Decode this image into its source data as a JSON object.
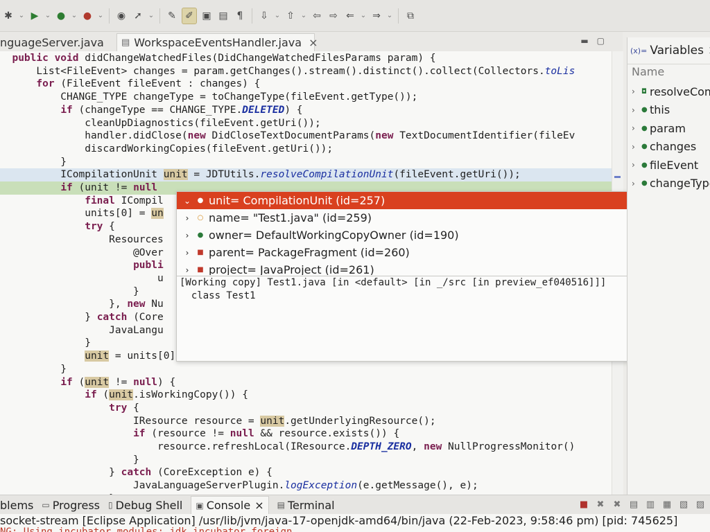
{
  "editor": {
    "tabs": [
      {
        "label": "nguageServer.java"
      },
      {
        "label": "WorkspaceEventsHandler.java",
        "close": "×"
      }
    ]
  },
  "code_lines": [
    [
      "  ",
      {
        "k": "public void"
      },
      " didChangeWatchedFiles(DidChangeWatchedFilesParams param) {"
    ],
    [
      "      List<FileEvent> changes = param.getChanges().stream().distinct().collect(Collectors.",
      {
        "f": "toLis"
      }
    ],
    [
      "      ",
      {
        "k": "for"
      },
      " (FileEvent fileEvent : changes) {"
    ],
    [
      "          CHANGE_TYPE changeType = toChangeType(fileEvent.getType());"
    ],
    [
      "          ",
      {
        "k": "if"
      },
      " (changeType == CHANGE_TYPE.",
      {
        "c": "DELETED"
      },
      ") {"
    ],
    [
      "              cleanUpDiagnostics(fileEvent.getUri());"
    ],
    [
      "              handler.didClose(",
      {
        "k": "new"
      },
      " DidCloseTextDocumentParams(",
      {
        "k": "new"
      },
      " TextDocumentIdentifier(fileEv"
    ],
    [
      "              discardWorkingCopies(fileEvent.getUri());"
    ],
    [
      "          }"
    ],
    [
      "          ICompilationUnit ",
      {
        "o": "unit"
      },
      " = JDTUtils.",
      {
        "f": "resolveCompilationUnit"
      },
      "(fileEvent.getUri());"
    ],
    [
      "          ",
      {
        "k": "if"
      },
      " (unit != ",
      {
        "k": "null"
      }
    ],
    [
      "              ",
      {
        "k": "final"
      },
      " ICompil"
    ],
    [
      "              units[0] = ",
      {
        "o": "un"
      }
    ],
    [
      "              ",
      {
        "k": "try"
      },
      " {"
    ],
    [
      "                  Resources"
    ],
    [
      "                      @Over"
    ],
    [
      "                      ",
      {
        "k": "publi"
      }
    ],
    [
      "                          u"
    ],
    [
      "                      }"
    ],
    [
      "                  }, ",
      {
        "k": "new"
      },
      " Nu"
    ],
    [
      "              } ",
      {
        "k": "catch"
      },
      " (Core"
    ],
    [
      "                  JavaLangu"
    ],
    [
      "              }"
    ],
    [
      "              ",
      {
        "o": "unit"
      },
      " = units[0];"
    ],
    [
      "          }"
    ],
    [
      "          ",
      {
        "k": "if"
      },
      " (",
      {
        "o": "unit"
      },
      " != ",
      {
        "k": "null"
      },
      ") {"
    ],
    [
      "              ",
      {
        "k": "if"
      },
      " (",
      {
        "o": "unit"
      },
      ".isWorkingCopy()) {"
    ],
    [
      "                  ",
      {
        "k": "try"
      },
      " {"
    ],
    [
      "                      IResource resource = ",
      {
        "o": "unit"
      },
      ".getUnderlyingResource();"
    ],
    [
      "                      ",
      {
        "k": "if"
      },
      " (resource != ",
      {
        "k": "null"
      },
      " && resource.exists()) {"
    ],
    [
      "                          resource.refreshLocal(IResource.",
      {
        "c": "DEPTH_ZERO"
      },
      ", ",
      {
        "k": "new"
      },
      " NullProgressMonitor()"
    ],
    [
      "                      }"
    ],
    [
      "                  } ",
      {
        "k": "catch"
      },
      " (CoreException e) {"
    ],
    [
      "                      JavaLanguageServerPlugin.",
      {
        "f": "logException"
      },
      "(e.getMessage(), e);"
    ],
    [
      "                  }"
    ]
  ],
  "hover": {
    "tree": [
      {
        "twisty": "⌄",
        "dot": "●",
        "dot_color": "blue",
        "label": "unit= CompilationUnit  (id=257)",
        "selected": true
      },
      {
        "twisty": "›",
        "dot": "○",
        "dot_color": "orange",
        "label": "name= \"Test1.java\" (id=259)"
      },
      {
        "twisty": "›",
        "dot": "●",
        "dot_color": "blue",
        "label": "owner= DefaultWorkingCopyOwner  (id=190)"
      },
      {
        "twisty": "›",
        "dot": "■",
        "dot_color": "red",
        "label": "parent= PackageFragment  (id=260)"
      },
      {
        "twisty": "›",
        "dot": "■",
        "dot_color": "red",
        "label": "project= JavaProject  (id=261)"
      }
    ],
    "detail": [
      "[Working copy] Test1.java [in <default> [in _/src [in preview_ef040516]]]",
      "  class Test1"
    ]
  },
  "variables": {
    "tab_label": "Variables",
    "tab_close": "×",
    "column_name": "Name",
    "items": [
      {
        "icon": "◘",
        "label": "resolveCom"
      },
      {
        "icon": "●",
        "label": "this"
      },
      {
        "icon": "●",
        "label": "param"
      },
      {
        "icon": "●",
        "label": "changes"
      },
      {
        "icon": "●",
        "label": "fileEvent"
      },
      {
        "icon": "●",
        "label": "changeType"
      }
    ]
  },
  "bottom": {
    "tabs": [
      {
        "label": "blems"
      },
      {
        "label": "Progress"
      },
      {
        "label": "Debug Shell"
      },
      {
        "label": "Console",
        "close": "×",
        "active": true
      },
      {
        "label": "Terminal"
      }
    ],
    "console_line": "socket-stream [Eclipse Application] /usr/lib/jvm/java-17-openjdk-amd64/bin/java  (22-Feb-2023, 9:58:46 pm) [pid: 745625]",
    "console_warning": "NG: Using incubator modules: jdk.incubator.foreign"
  },
  "colors": {
    "selection_red": "#d9401f",
    "current_line": "#c9dfb9",
    "keyword": "#7a1e4f",
    "static_field": "#1a2fa0"
  }
}
